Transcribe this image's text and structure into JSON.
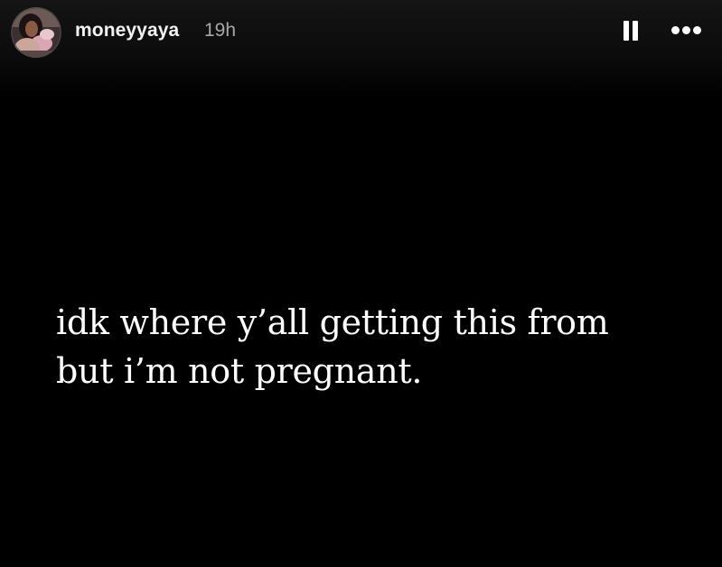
{
  "header": {
    "username": "moneyyaya",
    "timestamp": "19h",
    "avatar_icon": "profile-photo",
    "pause_icon": "pause-icon",
    "more_icon": "more-options-icon"
  },
  "story": {
    "background_color": "#000000",
    "text_color": "#ffffff",
    "lines": [
      "idk where y’all getting this from",
      "but i’m not pregnant."
    ]
  }
}
